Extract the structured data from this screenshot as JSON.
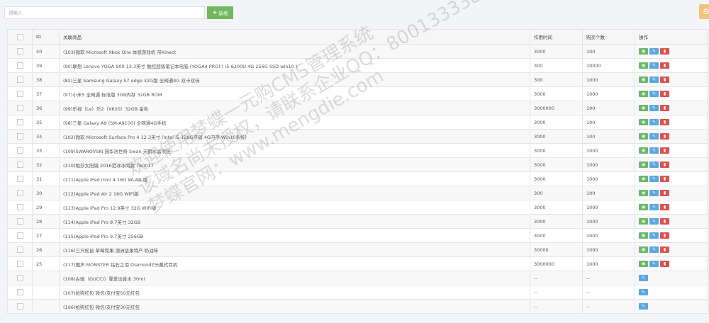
{
  "toolbar": {
    "search_placeholder": "请输入",
    "add_label": "新增",
    "add_icon": "plus-icon",
    "settings_icon": "gear-icon",
    "colors": {
      "add": "#70b85f",
      "settings": "#f3c37c"
    }
  },
  "table": {
    "columns": [
      "",
      "ID",
      "关联商品",
      "作用时间",
      "购买个数",
      "操作"
    ],
    "rows": [
      {
        "id": "40",
        "product": "(103)微软 Microsoft Xbox One 体感游戏机 带Kinect",
        "time": "3000",
        "count": "100",
        "ops": [
          "view",
          "edit",
          "delete"
        ]
      },
      {
        "id": "39",
        "product": "(90)联想 Lenovo YOGA 900 13.3英寸 触控超极笔记本电脑 (YOGA4 PRO) ( i5-6200U 4G 256G SSD win10 )",
        "time": "300",
        "count": "10000",
        "ops": [
          "view",
          "edit",
          "delete"
        ]
      },
      {
        "id": "38",
        "product": "(82)三星 Samsung Galaxy S7 edge 32G版 全网通4G 双卡双待",
        "time": "300",
        "count": "1000",
        "ops": [
          "view",
          "edit",
          "delete"
        ]
      },
      {
        "id": "37",
        "product": "(97)小米5 全网通 标准版 3GB内存 32GB ROM",
        "time": "3000",
        "count": "1000",
        "ops": [
          "view",
          "edit",
          "delete"
        ]
      },
      {
        "id": "36",
        "product": "(99)乐视（Le）乐2（X620）32GB 金色",
        "time": "3000000",
        "count": "100",
        "ops": [
          "view",
          "edit",
          "delete"
        ]
      },
      {
        "id": "35",
        "product": "(98)三星 Galaxy A9 (SM-A9100) 全网通4G手机",
        "time": "3000",
        "count": "100",
        "ops": [
          "view",
          "edit",
          "delete"
        ]
      },
      {
        "id": "34",
        "product": "(102)微软 Microsoft Surface Pro 4 12.3英寸 (Intel i5 128G存储 4G内存 Win10系统)",
        "time": "3000",
        "count": "100",
        "ops": [
          "view",
          "edit",
          "delete"
        ]
      },
      {
        "id": "33",
        "product": "(109)SWAROVSKI 施华洛世奇 Swan 天鹅水晶项链",
        "time": "3000",
        "count": "1000",
        "ops": [
          "view",
          "edit",
          "delete"
        ]
      },
      {
        "id": "32",
        "product": "(110)帕莎太阳镜 2016范冰冰同款 T60017",
        "time": "3000",
        "count": "1000",
        "ops": [
          "view",
          "edit",
          "delete"
        ]
      },
      {
        "id": "31",
        "product": "(111)Apple iPad mini 4 16G WLAN 版",
        "time": "3000",
        "count": "1000",
        "ops": [
          "view",
          "edit",
          "delete"
        ]
      },
      {
        "id": "30",
        "product": "(112)Apple iPad Air 2 16G WIFI版",
        "time": "300",
        "count": "100",
        "ops": [
          "view",
          "edit",
          "delete"
        ]
      },
      {
        "id": "29",
        "product": "(113)Apple iPad Pro 12.9英寸 32G WIFI版",
        "time": "3000",
        "count": "1000",
        "ops": [
          "view",
          "edit",
          "delete"
        ]
      },
      {
        "id": "28",
        "product": "(114)Apple iPad Pro 9.7英寸 32GB",
        "time": "3000",
        "count": "1000",
        "ops": [
          "view",
          "edit",
          "delete"
        ]
      },
      {
        "id": "27",
        "product": "(115)Apple iPad Pro 9.7英寸 256GB",
        "time": "3000",
        "count": "1000",
        "ops": [
          "view",
          "edit",
          "delete"
        ]
      },
      {
        "id": "26",
        "product": "(116)三只松鼠 草莓兜果 澳洲坚果特产 奶油味",
        "time": "30000",
        "count": "1000",
        "ops": [
          "view",
          "edit",
          "delete"
        ]
      },
      {
        "id": "25",
        "product": "(117)魔声 MONSTER 钻石之泪 DiamondZ头戴式耳机",
        "time": "3000000",
        "count": "1000",
        "ops": [
          "view",
          "edit",
          "delete"
        ]
      },
      {
        "id": "",
        "product": "(108)古驰（GUCCI）罪爱淡香水 30ml",
        "time": "--",
        "count": "--",
        "ops": [
          "edit"
        ]
      },
      {
        "id": "",
        "product": "(107)抢购红包 微信/支付宝50元红包",
        "time": "--",
        "count": "--",
        "ops": [
          "edit"
        ]
      },
      {
        "id": "",
        "product": "(106)抢购红包 微信/支付宝30元红包",
        "time": "--",
        "count": "--",
        "ops": [
          "edit"
        ]
      }
    ]
  },
  "watermark": {
    "lines": [
      "欢迎使用梦蝶一元购CMS管理系统",
      "该域名尚未授权，请联系企业QQ：800133338",
      "梦蝶官网：www.mengdie.com"
    ]
  }
}
